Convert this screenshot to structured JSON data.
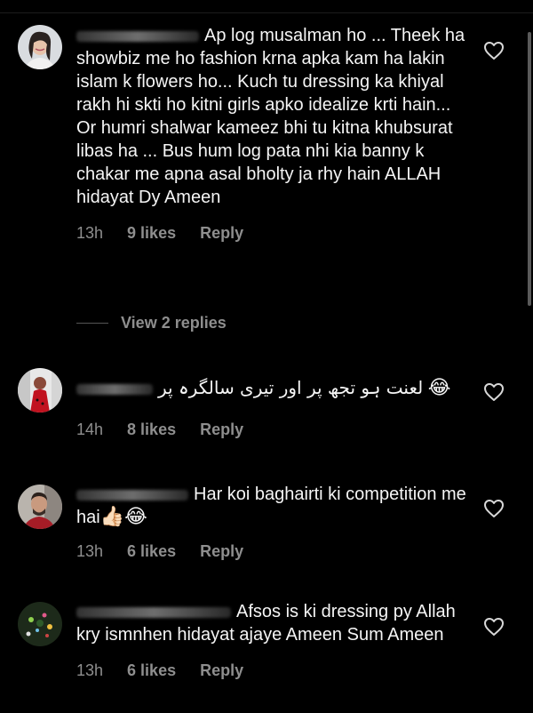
{
  "comments": [
    {
      "username": "..., .. ,. ..",
      "text": "Ap log musalman ho ... Theek ha showbiz me ho fashion krna apka kam ha lakin islam k flowers ho... Kuch tu dressing ka khiyal rakh hi skti ho kitni girls apko idealize krti hain... Or humri shalwar kameez bhi tu kitna khubsurat libas ha ... Bus hum log pata nhi kia banny k chakar me apna asal bholty ja rhy hain ALLAH hidayat Dy Ameen",
      "time": "13h",
      "likes": "9 likes",
      "reply": "Reply",
      "view_replies": "View 2 replies"
    },
    {
      "username": "j......:......",
      "text": "لعنت ہو تجھ پر اور تیری سالگرہ پر",
      "emoji": "😂",
      "time": "14h",
      "likes": "8 likes",
      "reply": "Reply"
    },
    {
      "username": "naseer",
      "text": "Har koi baghairti ki competition me hai",
      "emoji": "👍🏻😂",
      "time": "13h",
      "likes": "6 likes",
      "reply": "Reply"
    },
    {
      "username": "v",
      "text": "Afsos is ki dressing py Allah kry ismnhen hidayat ajaye Ameen Sum Ameen",
      "time": "13h",
      "likes": "6 likes",
      "reply": "Reply"
    }
  ],
  "icons": {
    "like": "heart-outline-icon"
  },
  "colors": {
    "background": "#000000",
    "text": "#f5f5f5",
    "secondary": "#8e8e8e"
  }
}
